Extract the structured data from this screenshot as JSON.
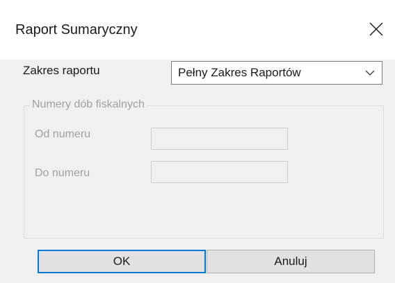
{
  "window": {
    "title": "Raport Sumaryczny",
    "close_icon": "close-icon"
  },
  "range": {
    "label": "Zakres raportu",
    "selected": "Pełny Zakres Raportów",
    "dropdown_icon": "chevron-down-icon"
  },
  "group": {
    "legend": "Numery dób fiskalnych",
    "from_label": "Od numeru",
    "from_value": "",
    "to_label": "Do numeru",
    "to_value": "",
    "enabled": false
  },
  "buttons": {
    "ok": "OK",
    "cancel": "Anuluj"
  },
  "colors": {
    "focus_border": "#0078d7",
    "dialog_bg": "#f0f0f0",
    "disabled_text": "#a0a0a0"
  }
}
